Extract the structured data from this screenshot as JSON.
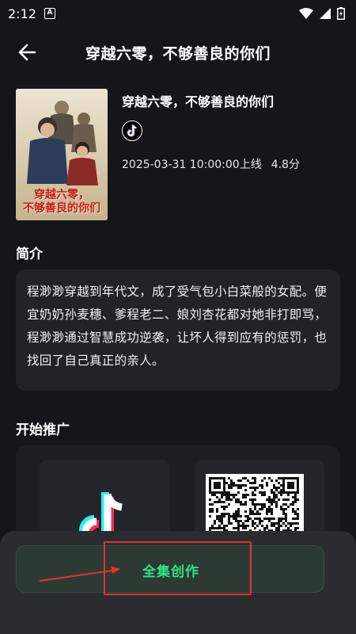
{
  "status_bar": {
    "time": "2:12",
    "notif_badge": "A"
  },
  "header": {
    "title": "穿越六零，不够善良的你们"
  },
  "drama": {
    "title": "穿越六零，不够善良的你们",
    "platform_icon": "tiktok-icon",
    "release": "2025-03-31 10:00:00上线",
    "rating": "4.8分",
    "poster_title_line1": "穿越六零，",
    "poster_title_line2": "不够善良的你们"
  },
  "synopsis": {
    "heading": "简介",
    "text": "程渺渺穿越到年代文，成了受气包小白菜般的女配。便宜奶奶孙麦穗、爹程老二、娘刘杏花都对她非打即骂，程渺渺通过智慧成功逆袭，让坏人得到应有的惩罚，也找回了自己真正的亲人。"
  },
  "promote": {
    "heading": "开始推广"
  },
  "bottom": {
    "button_label": "全集创作"
  },
  "colors": {
    "accent_green": "#2ee58a",
    "annotation_red": "#e53030",
    "background": "#15161a"
  }
}
